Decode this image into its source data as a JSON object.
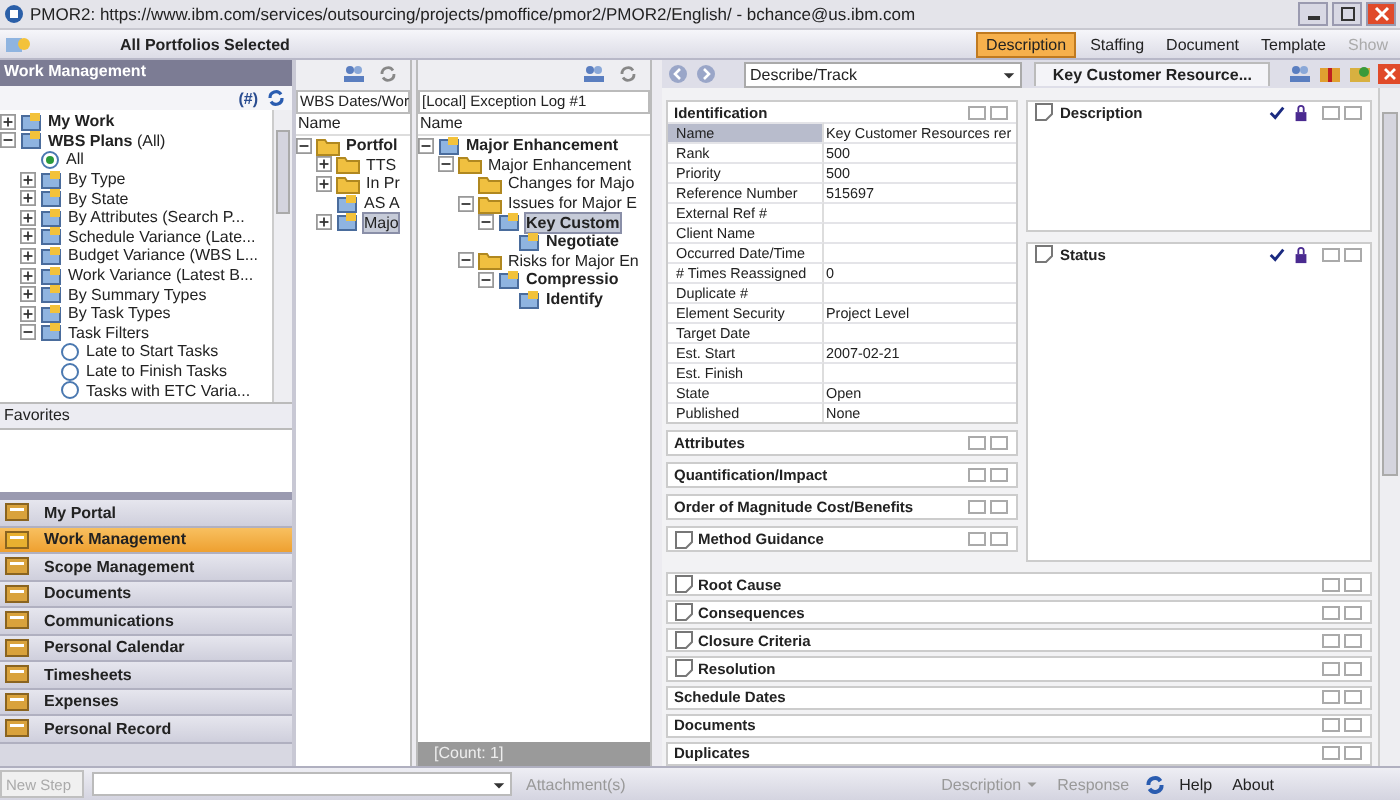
{
  "window": {
    "title": "PMOR2: https://www.ibm.com/services/outsourcing/projects/pmoffice/pmor2/PMOR2/English/ - bchance@us.ibm.com"
  },
  "toolbar": {
    "context": "All Portfolios Selected",
    "buttons": [
      {
        "label": "Description",
        "selected": true,
        "disabled": false
      },
      {
        "label": "Staffing",
        "selected": false,
        "disabled": false
      },
      {
        "label": "Document",
        "selected": false,
        "disabled": false
      },
      {
        "label": "Template",
        "selected": false,
        "disabled": false
      },
      {
        "label": "Show",
        "selected": false,
        "disabled": true
      }
    ]
  },
  "sidebar": {
    "title": "Work Management",
    "count_label": "(#)",
    "tree": [
      {
        "label": "My Work",
        "kind": "item",
        "bold": true,
        "selected": false,
        "expanded": false
      },
      {
        "label": "**WBS Plans** (All)",
        "kind": "item",
        "bold": false,
        "selected": false,
        "expanded": true,
        "children": [
          {
            "label": "All",
            "kind": "radio",
            "bold": false,
            "selected": true
          },
          {
            "label": "By Type",
            "kind": "item",
            "bold": false,
            "selected": false,
            "expanded": false
          },
          {
            "label": "By State",
            "kind": "item",
            "bold": false,
            "selected": false,
            "expanded": false
          },
          {
            "label": "By Attributes (Search P...",
            "kind": "item",
            "bold": false,
            "selected": false,
            "expanded": false
          },
          {
            "label": "Schedule Variance (Late...",
            "kind": "item",
            "bold": false,
            "selected": false,
            "expanded": false
          },
          {
            "label": "Budget Variance (WBS L...",
            "kind": "item",
            "bold": false,
            "selected": false,
            "expanded": false
          },
          {
            "label": "Work Variance (Latest B...",
            "kind": "item",
            "bold": false,
            "selected": false,
            "expanded": false
          },
          {
            "label": "By Summary Types",
            "kind": "item",
            "bold": false,
            "selected": false,
            "expanded": false
          },
          {
            "label": "By Task Types",
            "kind": "item",
            "bold": false,
            "selected": false,
            "expanded": false
          },
          {
            "label": "Task Filters",
            "kind": "item",
            "bold": false,
            "selected": false,
            "expanded": true,
            "children": [
              {
                "label": "Late to Start Tasks",
                "kind": "radio",
                "bold": false,
                "selected": false
              },
              {
                "label": "Late to Finish Tasks",
                "kind": "radio",
                "bold": false,
                "selected": false
              },
              {
                "label": "Tasks with ETC Varia...",
                "kind": "radio",
                "bold": false,
                "selected": false
              }
            ]
          }
        ]
      }
    ],
    "favorites_label": "Favorites",
    "nav": [
      {
        "label": "My Portal",
        "selected": false
      },
      {
        "label": "Work Management",
        "selected": true
      },
      {
        "label": "Scope Management",
        "selected": false
      },
      {
        "label": "Documents",
        "selected": false
      },
      {
        "label": "Communications",
        "selected": false
      },
      {
        "label": "Personal Calendar",
        "selected": false
      },
      {
        "label": "Timesheets",
        "selected": false
      },
      {
        "label": "Expenses",
        "selected": false
      },
      {
        "label": "Personal Record",
        "selected": false
      }
    ]
  },
  "wbs_panel": {
    "header": "WBS Dates/Wor",
    "column": "Name",
    "tree": [
      {
        "label": "Portfol",
        "kind": "folder",
        "bold": true,
        "selected": false,
        "expanded": true,
        "children": [
          {
            "label": "TTS",
            "kind": "folder",
            "bold": false,
            "selected": false,
            "expanded": false
          },
          {
            "label": "In Pr",
            "kind": "folder",
            "bold": false,
            "selected": false,
            "expanded": false
          },
          {
            "label": "AS A",
            "kind": "item",
            "bold": false,
            "selected": false
          },
          {
            "label": "Majo",
            "kind": "item",
            "bold": false,
            "selected": true,
            "expanded": false
          }
        ]
      }
    ]
  },
  "log_panel": {
    "header": "[Local] Exception Log #1",
    "column": "Name",
    "count": "[Count: 1]",
    "tree": [
      {
        "label": "Major Enhancement",
        "kind": "item",
        "bold": true,
        "selected": false,
        "expanded": true,
        "children": [
          {
            "label": "Major Enhancement",
            "kind": "folder",
            "bold": false,
            "selected": false,
            "expanded": true,
            "children": [
              {
                "label": "Changes for Majo",
                "kind": "folder",
                "bold": false,
                "selected": false
              },
              {
                "label": "Issues for Major E",
                "kind": "folder",
                "bold": false,
                "selected": false,
                "expanded": true,
                "children": [
                  {
                    "label": "Key Custom",
                    "kind": "item",
                    "bold": true,
                    "selected": true,
                    "expanded": true,
                    "children": [
                      {
                        "label": "Negotiate",
                        "kind": "item",
                        "bold": true,
                        "selected": false
                      }
                    ]
                  }
                ]
              },
              {
                "label": "Risks for Major En",
                "kind": "folder",
                "bold": false,
                "selected": false,
                "expanded": true,
                "children": [
                  {
                    "label": "Compressio",
                    "kind": "item",
                    "bold": true,
                    "selected": false,
                    "expanded": true,
                    "children": [
                      {
                        "label": "Identify",
                        "kind": "item",
                        "bold": true,
                        "selected": false
                      }
                    ]
                  }
                ]
              }
            ]
          }
        ]
      }
    ]
  },
  "detail": {
    "view": "Describe/Track",
    "identification": {
      "title": "Identification",
      "fields": [
        {
          "label": "Name",
          "value": "Key Customer Resources rer",
          "selected": true
        },
        {
          "label": "Rank",
          "value": "500",
          "selected": false
        },
        {
          "label": "Priority",
          "value": "500",
          "selected": false
        },
        {
          "label": "Reference Number",
          "value": "515697",
          "selected": false
        },
        {
          "label": "External Ref #",
          "selected": false
        },
        {
          "label": "Client Name",
          "selected": false
        },
        {
          "label": "Occurred Date/Time",
          "selected": false
        },
        {
          "label": "# Times Reassigned",
          "value": "0",
          "selected": false
        },
        {
          "label": "Duplicate #",
          "selected": false
        },
        {
          "label": "Element Security",
          "value": "Project Level",
          "selected": false
        },
        {
          "label": "Target Date",
          "selected": false
        },
        {
          "label": "Est. Start",
          "value": "2007-02-21",
          "selected": false
        },
        {
          "label": "Est. Finish",
          "selected": false
        },
        {
          "label": "State",
          "value": "Open",
          "selected": false
        },
        {
          "label": "Published",
          "value": "None",
          "selected": false
        }
      ]
    },
    "sections": [
      {
        "title": "Attributes",
        "kind": "plain"
      },
      {
        "title": "Quantification/Impact",
        "kind": "plain"
      },
      {
        "title": "Order of Magnitude Cost/Benefits",
        "kind": "plain"
      },
      {
        "title": "Method Guidance",
        "kind": "note"
      }
    ],
    "wide_sections": [
      {
        "title": "Root Cause",
        "kind": "note"
      },
      {
        "title": "Consequences",
        "kind": "note"
      },
      {
        "title": "Closure Criteria",
        "kind": "note"
      },
      {
        "title": "Resolution",
        "kind": "note"
      },
      {
        "title": "Schedule Dates",
        "kind": "plain"
      },
      {
        "title": "Documents",
        "kind": "plain"
      },
      {
        "title": "Duplicates",
        "kind": "plain"
      }
    ]
  },
  "right": {
    "tab": "Key Customer Resource...",
    "panels": [
      {
        "title": "Description"
      },
      {
        "title": "Status"
      }
    ]
  },
  "bottom": {
    "new_step_placeholder": "New Step",
    "attachments": "Attachment(s)",
    "description": "Description",
    "response": "Response",
    "help": "Help",
    "about": "About"
  }
}
